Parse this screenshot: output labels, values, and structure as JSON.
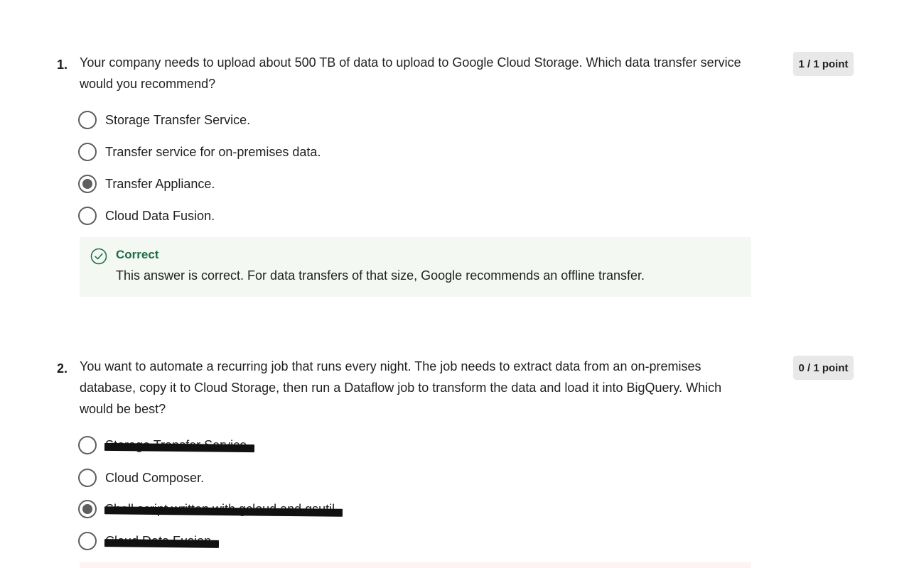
{
  "questions": [
    {
      "number": "1.",
      "text": "Your company needs to upload about 500 TB of data to upload to Google Cloud Storage. Which data transfer service would you recommend?",
      "score": "1 / 1 point",
      "options": [
        {
          "label": "Storage Transfer Service.",
          "selected": false
        },
        {
          "label": "Transfer service for on-premises data.",
          "selected": false
        },
        {
          "label": "Transfer Appliance.",
          "selected": true
        },
        {
          "label": "Cloud Data Fusion.",
          "selected": false
        }
      ],
      "feedback": {
        "title": "Correct",
        "text": "This answer is correct. For data transfers of that size, Google recommends an offline transfer.",
        "icon": "check-circle-icon",
        "color": "#1e6b45",
        "background": "#f3f8f3"
      }
    },
    {
      "number": "2.",
      "text": "You want to automate a recurring job that runs every night. The job needs to extract data from an on-premises database, copy it to Cloud Storage, then run a Dataflow job to transform the data and load it into BigQuery. Which would be best?",
      "score": "0 / 1 point",
      "options": [
        {
          "label": "Storage Transfer Service.",
          "selected": false,
          "redacted": true
        },
        {
          "label": "Cloud Composer.",
          "selected": false
        },
        {
          "label": "Shell script written with gcloud and gsutil.",
          "selected": true,
          "redacted": true
        },
        {
          "label": "Cloud Data Fusion.",
          "selected": false,
          "redacted": true
        }
      ]
    }
  ]
}
